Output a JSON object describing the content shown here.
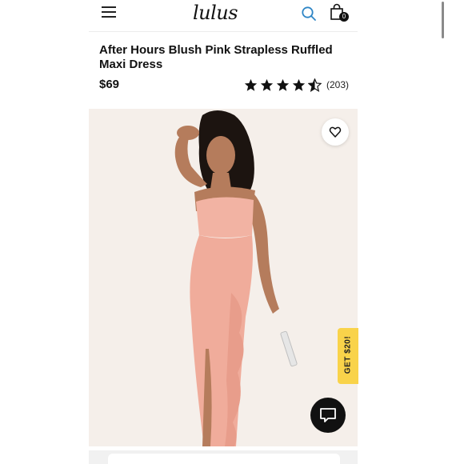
{
  "header": {
    "logo_text": "lulus",
    "cart_count": "0",
    "icons": [
      "hamburger-menu-icon",
      "search-icon",
      "shopping-bag-icon"
    ],
    "search_icon_color": "#2f86c6"
  },
  "product": {
    "title": "After Hours Blush Pink Strapless Ruffled Maxi Dress",
    "price": "$69",
    "rating": 4.5,
    "review_count": "(203)",
    "image_description_colors": {
      "dress": "#f2b3a3",
      "background": "#f5efea"
    }
  },
  "promo": {
    "label": "GET $20!",
    "color": "#f9d34a"
  },
  "chat": {
    "icon": "chat-bubble-icon"
  },
  "wishlist": {
    "icon": "heart-icon"
  }
}
